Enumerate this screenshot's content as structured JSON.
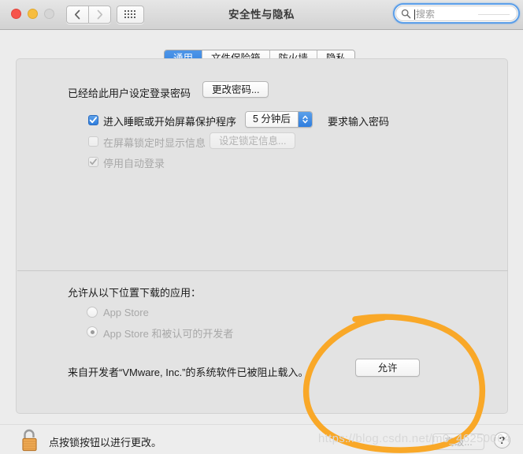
{
  "window": {
    "title": "安全性与隐私",
    "traffic_lights": [
      "close",
      "minimize",
      "zoom"
    ],
    "nav_back_icon": "chevron-left-icon",
    "nav_forward_icon": "chevron-right-icon",
    "show_all_icon": "grid-dots-icon"
  },
  "search": {
    "placeholder": "搜索",
    "value": "",
    "icon": "search-icon",
    "focused": true,
    "accent": "#5b9ee8"
  },
  "tabs": [
    {
      "label": "通用",
      "active": true
    },
    {
      "label": "文件保险箱",
      "active": false
    },
    {
      "label": "防火墙",
      "active": false
    },
    {
      "label": "隐私",
      "active": false
    }
  ],
  "general": {
    "password_set_label": "已经给此用户设定登录密码",
    "change_password_button": "更改密码...",
    "require_password_checkbox": {
      "label": "进入睡眠或开始屏幕保护程序",
      "checked": true,
      "enabled": true
    },
    "require_password_delay": {
      "value": "5 分钟后",
      "icon": "up-down-chevron-icon"
    },
    "require_password_suffix": "要求输入密码",
    "show_lock_message_checkbox": {
      "label": "在屏幕锁定时显示信息",
      "checked": false,
      "enabled": false
    },
    "set_lock_message_button": {
      "label": "设定锁定信息...",
      "enabled": false
    },
    "disable_auto_login_checkbox": {
      "label": "停用自动登录",
      "checked": true,
      "enabled": false
    }
  },
  "downloads": {
    "heading": "允许从以下位置下载的应用：",
    "options": [
      {
        "label": "App Store",
        "selected": false,
        "enabled": false
      },
      {
        "label": "App Store 和被认可的开发者",
        "selected": true,
        "enabled": false
      }
    ],
    "blocked_message": "来自开发者“VMware, Inc.”的系统软件已被阻止载入。",
    "allow_button": "允许"
  },
  "bottom_bar": {
    "lock_icon": "unlocked-padlock-icon",
    "lock_message": "点按锁按钮以进行更改。",
    "advanced_button": {
      "label": "高级...",
      "enabled": false
    },
    "help_button": "?"
  },
  "annotation": {
    "type": "hand-drawn-circle",
    "color": "#f9a828",
    "target": "允许"
  },
  "watermark": "https://blog.csdn.net/m0_46250064"
}
